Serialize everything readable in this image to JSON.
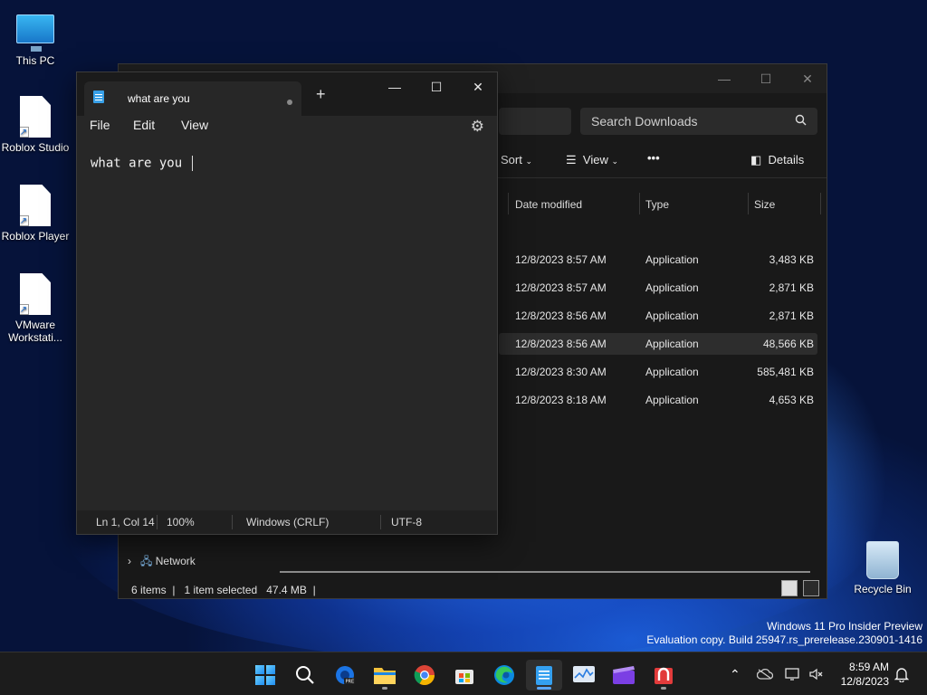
{
  "desktop": {
    "icons": [
      {
        "label": "This PC"
      },
      {
        "label": "Roblox Studio"
      },
      {
        "label": "Roblox Player"
      },
      {
        "label": "VMware Workstati..."
      },
      {
        "label": "Recycle Bin"
      }
    ],
    "watermark": {
      "line1": "Windows 11 Pro Insider Preview",
      "line2": "Evaluation copy. Build 25947.rs_prerelease.230901-1416"
    }
  },
  "explorer": {
    "search_placeholder": "Search Downloads",
    "toolbar": {
      "sort": "Sort",
      "view": "View",
      "more": "•••",
      "details": "Details"
    },
    "columns": {
      "date": "Date modified",
      "type": "Type",
      "size": "Size"
    },
    "files": [
      {
        "date": "12/8/2023 8:57 AM",
        "type": "Application",
        "size": "3,483 KB"
      },
      {
        "date": "12/8/2023 8:57 AM",
        "type": "Application",
        "size": "2,871 KB"
      },
      {
        "date": "12/8/2023 8:56 AM",
        "type": "Application",
        "size": "2,871 KB"
      },
      {
        "date": "12/8/2023 8:56 AM",
        "type": "Application",
        "size": "48,566 KB"
      },
      {
        "date": "12/8/2023 8:30 AM",
        "type": "Application",
        "size": "585,481 KB"
      },
      {
        "date": "12/8/2023 8:18 AM",
        "type": "Application",
        "size": "4,653 KB"
      }
    ],
    "nav_network": "Network",
    "status": {
      "items": "6 items",
      "selected": "1 item selected",
      "selected_size": "47.4 MB"
    }
  },
  "notepad": {
    "tab_title": "what are you",
    "menu": {
      "file": "File",
      "edit": "Edit",
      "view": "View"
    },
    "content": "what are you ",
    "status": {
      "position": "Ln 1, Col 14",
      "zoom": "100%",
      "line_ending": "Windows (CRLF)",
      "encoding": "UTF-8"
    }
  },
  "taskbar": {
    "clock": {
      "time": "8:59 AM",
      "date": "12/8/2023"
    },
    "pinned": [
      "start-icon",
      "search-icon",
      "edge-beta-icon",
      "file-explorer-icon",
      "chrome-icon",
      "store-icon",
      "edge-icon",
      "notepad-icon",
      "task-manager-icon",
      "video-editor-icon",
      "installer-icon"
    ]
  }
}
